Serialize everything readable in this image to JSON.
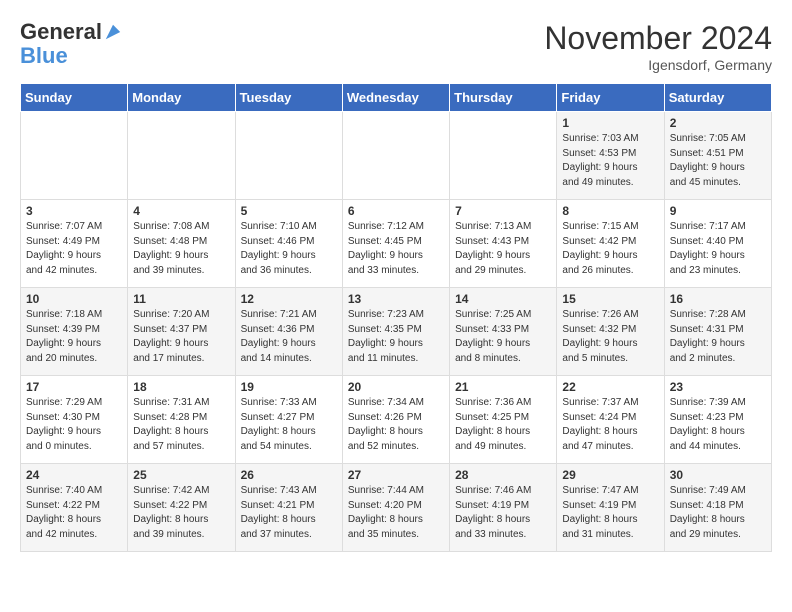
{
  "logo": {
    "line1": "General",
    "line2": "Blue"
  },
  "title": "November 2024",
  "location": "Igensdorf, Germany",
  "days_header": [
    "Sunday",
    "Monday",
    "Tuesday",
    "Wednesday",
    "Thursday",
    "Friday",
    "Saturday"
  ],
  "weeks": [
    [
      {
        "num": "",
        "info": ""
      },
      {
        "num": "",
        "info": ""
      },
      {
        "num": "",
        "info": ""
      },
      {
        "num": "",
        "info": ""
      },
      {
        "num": "",
        "info": ""
      },
      {
        "num": "1",
        "info": "Sunrise: 7:03 AM\nSunset: 4:53 PM\nDaylight: 9 hours\nand 49 minutes."
      },
      {
        "num": "2",
        "info": "Sunrise: 7:05 AM\nSunset: 4:51 PM\nDaylight: 9 hours\nand 45 minutes."
      }
    ],
    [
      {
        "num": "3",
        "info": "Sunrise: 7:07 AM\nSunset: 4:49 PM\nDaylight: 9 hours\nand 42 minutes."
      },
      {
        "num": "4",
        "info": "Sunrise: 7:08 AM\nSunset: 4:48 PM\nDaylight: 9 hours\nand 39 minutes."
      },
      {
        "num": "5",
        "info": "Sunrise: 7:10 AM\nSunset: 4:46 PM\nDaylight: 9 hours\nand 36 minutes."
      },
      {
        "num": "6",
        "info": "Sunrise: 7:12 AM\nSunset: 4:45 PM\nDaylight: 9 hours\nand 33 minutes."
      },
      {
        "num": "7",
        "info": "Sunrise: 7:13 AM\nSunset: 4:43 PM\nDaylight: 9 hours\nand 29 minutes."
      },
      {
        "num": "8",
        "info": "Sunrise: 7:15 AM\nSunset: 4:42 PM\nDaylight: 9 hours\nand 26 minutes."
      },
      {
        "num": "9",
        "info": "Sunrise: 7:17 AM\nSunset: 4:40 PM\nDaylight: 9 hours\nand 23 minutes."
      }
    ],
    [
      {
        "num": "10",
        "info": "Sunrise: 7:18 AM\nSunset: 4:39 PM\nDaylight: 9 hours\nand 20 minutes."
      },
      {
        "num": "11",
        "info": "Sunrise: 7:20 AM\nSunset: 4:37 PM\nDaylight: 9 hours\nand 17 minutes."
      },
      {
        "num": "12",
        "info": "Sunrise: 7:21 AM\nSunset: 4:36 PM\nDaylight: 9 hours\nand 14 minutes."
      },
      {
        "num": "13",
        "info": "Sunrise: 7:23 AM\nSunset: 4:35 PM\nDaylight: 9 hours\nand 11 minutes."
      },
      {
        "num": "14",
        "info": "Sunrise: 7:25 AM\nSunset: 4:33 PM\nDaylight: 9 hours\nand 8 minutes."
      },
      {
        "num": "15",
        "info": "Sunrise: 7:26 AM\nSunset: 4:32 PM\nDaylight: 9 hours\nand 5 minutes."
      },
      {
        "num": "16",
        "info": "Sunrise: 7:28 AM\nSunset: 4:31 PM\nDaylight: 9 hours\nand 2 minutes."
      }
    ],
    [
      {
        "num": "17",
        "info": "Sunrise: 7:29 AM\nSunset: 4:30 PM\nDaylight: 9 hours\nand 0 minutes."
      },
      {
        "num": "18",
        "info": "Sunrise: 7:31 AM\nSunset: 4:28 PM\nDaylight: 8 hours\nand 57 minutes."
      },
      {
        "num": "19",
        "info": "Sunrise: 7:33 AM\nSunset: 4:27 PM\nDaylight: 8 hours\nand 54 minutes."
      },
      {
        "num": "20",
        "info": "Sunrise: 7:34 AM\nSunset: 4:26 PM\nDaylight: 8 hours\nand 52 minutes."
      },
      {
        "num": "21",
        "info": "Sunrise: 7:36 AM\nSunset: 4:25 PM\nDaylight: 8 hours\nand 49 minutes."
      },
      {
        "num": "22",
        "info": "Sunrise: 7:37 AM\nSunset: 4:24 PM\nDaylight: 8 hours\nand 47 minutes."
      },
      {
        "num": "23",
        "info": "Sunrise: 7:39 AM\nSunset: 4:23 PM\nDaylight: 8 hours\nand 44 minutes."
      }
    ],
    [
      {
        "num": "24",
        "info": "Sunrise: 7:40 AM\nSunset: 4:22 PM\nDaylight: 8 hours\nand 42 minutes."
      },
      {
        "num": "25",
        "info": "Sunrise: 7:42 AM\nSunset: 4:22 PM\nDaylight: 8 hours\nand 39 minutes."
      },
      {
        "num": "26",
        "info": "Sunrise: 7:43 AM\nSunset: 4:21 PM\nDaylight: 8 hours\nand 37 minutes."
      },
      {
        "num": "27",
        "info": "Sunrise: 7:44 AM\nSunset: 4:20 PM\nDaylight: 8 hours\nand 35 minutes."
      },
      {
        "num": "28",
        "info": "Sunrise: 7:46 AM\nSunset: 4:19 PM\nDaylight: 8 hours\nand 33 minutes."
      },
      {
        "num": "29",
        "info": "Sunrise: 7:47 AM\nSunset: 4:19 PM\nDaylight: 8 hours\nand 31 minutes."
      },
      {
        "num": "30",
        "info": "Sunrise: 7:49 AM\nSunset: 4:18 PM\nDaylight: 8 hours\nand 29 minutes."
      }
    ]
  ]
}
